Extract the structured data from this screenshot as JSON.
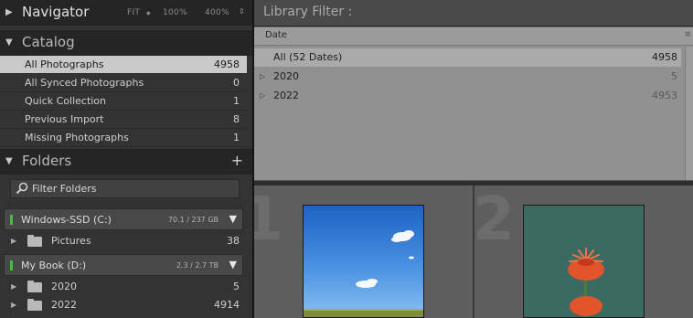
{
  "navigator": {
    "title": "Navigator",
    "zoom_options": [
      "FIT",
      "100%",
      "400%"
    ]
  },
  "catalog": {
    "title": "Catalog",
    "items": [
      {
        "label": "All Photographs",
        "count": "4958"
      },
      {
        "label": "All Synced Photographs",
        "count": "0"
      },
      {
        "label": "Quick Collection",
        "count": "1"
      },
      {
        "label": "Previous Import",
        "count": "8"
      },
      {
        "label": "Missing Photographs",
        "count": "1"
      }
    ]
  },
  "folders": {
    "title": "Folders",
    "filter_label": "Filter Folders",
    "volumes": [
      {
        "name": "Windows-SSD (C:)",
        "size": "70.1 / 237 GB",
        "led_color": "#4fb54f"
      },
      {
        "name": "My Book (D:)",
        "size": "2.3 / 2.7 TB",
        "led_color": "#4fb54f"
      }
    ],
    "items": [
      {
        "label": "Pictures",
        "count": "38"
      },
      {
        "label": "2020",
        "count": "5"
      },
      {
        "label": "2022",
        "count": "4914"
      }
    ]
  },
  "library_filter": {
    "title": "Library Filter :",
    "column_header": "Date",
    "rows": [
      {
        "label": "All (52 Dates)",
        "count": "4958"
      },
      {
        "label": "2020",
        "count": "5"
      },
      {
        "label": "2022",
        "count": "4953"
      }
    ]
  },
  "grid": {
    "cell_numbers": [
      "1",
      "2"
    ]
  },
  "colors": {
    "selected_row": "#c9c9c9",
    "panel_bg": "#333333"
  }
}
